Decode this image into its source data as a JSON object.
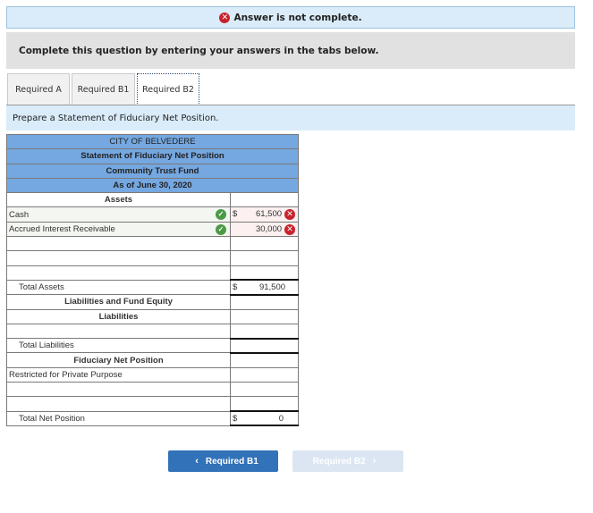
{
  "banner": {
    "status_text": "Answer is not complete.",
    "status_icon": "x-circle-icon",
    "status_color": "#c8232c"
  },
  "instruction": "Complete this question by entering your answers in the tabs below.",
  "tabs": [
    {
      "label": "Required A",
      "active": false
    },
    {
      "label": "Required B1",
      "active": false
    },
    {
      "label": "Required B2",
      "active": true
    }
  ],
  "prompt": "Prepare a Statement of Fiduciary Net Position.",
  "statement": {
    "header": [
      "CITY OF BELVEDERE",
      "Statement of Fiduciary Net Position",
      "Community Trust Fund",
      "As of June 30, 2020"
    ],
    "assets_heading": "Assets",
    "cash": {
      "label": "Cash",
      "currency": "$",
      "value": "61,500",
      "label_correct": true,
      "value_correct": false
    },
    "accrued": {
      "label": "Accrued Interest Receivable",
      "value": "30,000",
      "label_correct": true,
      "value_correct": false
    },
    "total_assets": {
      "label": "Total Assets",
      "currency": "$",
      "value": "91,500"
    },
    "liab_fund_heading": "Liabilities and Fund Equity",
    "liabilities_heading": "Liabilities",
    "total_liabilities": {
      "label": "Total Liabilities",
      "value": ""
    },
    "fiduciary_heading": "Fiduciary Net Position",
    "restricted": {
      "label": "Restricted for Private Purpose",
      "value": ""
    },
    "total_net_position": {
      "label": "Total Net Position",
      "currency": "$",
      "value": "0"
    }
  },
  "nav": {
    "prev_label": "Required B1",
    "next_label": "Required B2",
    "prev_chevron": "‹",
    "next_chevron": "›"
  },
  "icons": {
    "check": "✓",
    "x": "✕"
  },
  "colors": {
    "header_blue": "#75a7e0",
    "banner_bg": "#daecf9",
    "correct_green": "#4c9a46",
    "incorrect_red": "#c8232c",
    "button_blue": "#3272b8"
  }
}
